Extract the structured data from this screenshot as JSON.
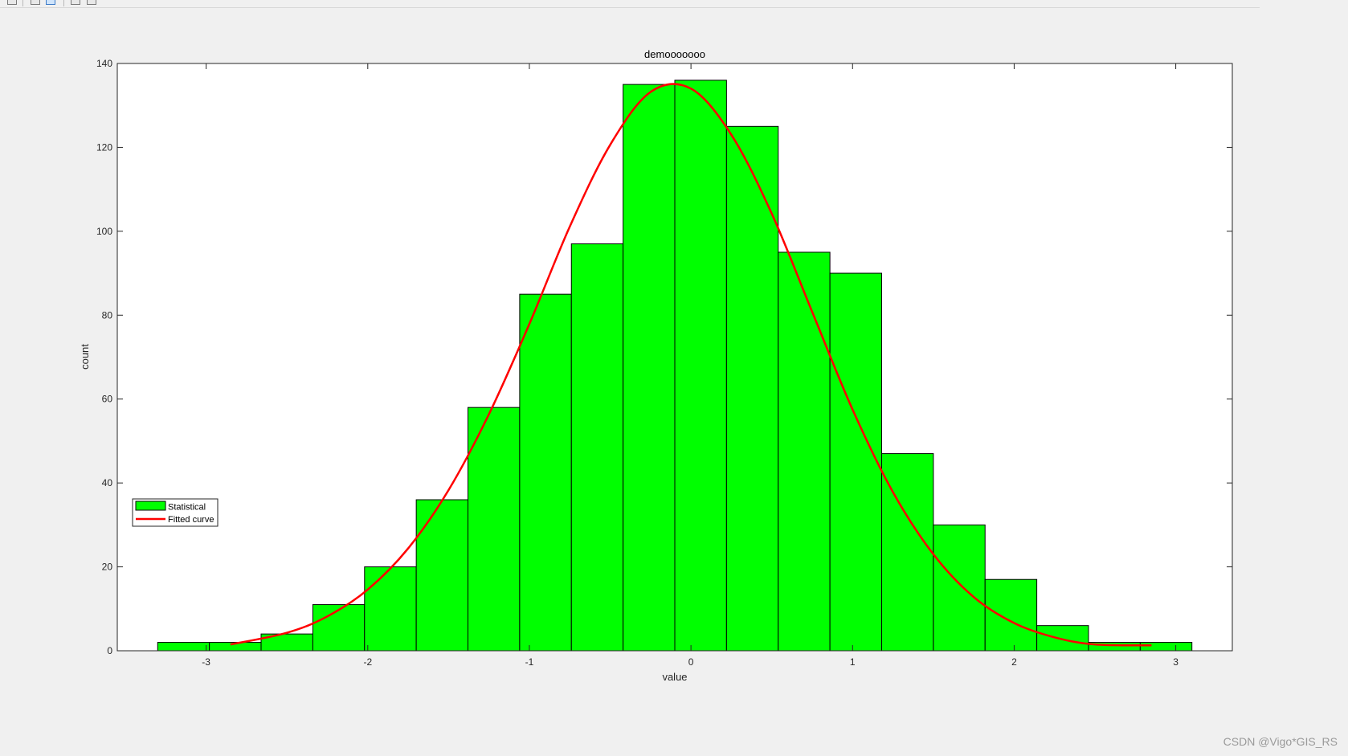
{
  "toolbar": {
    "buttons": [
      "save-icon",
      "print-icon",
      "zoom-icon",
      "pointer-icon",
      "data-cursor-icon"
    ]
  },
  "watermark": "CSDN @Vigo*GIS_RS",
  "chart_data": {
    "type": "bar",
    "title": "demooooooo",
    "xlabel": "value",
    "ylabel": "count",
    "xlim": [
      -3.55,
      3.35
    ],
    "ylim": [
      0,
      140
    ],
    "xticks": [
      -3,
      -2,
      -1,
      0,
      1,
      2,
      3
    ],
    "yticks": [
      0,
      20,
      40,
      60,
      80,
      100,
      120,
      140
    ],
    "bar_color": "#00ff00",
    "curve_color": "#ff0000",
    "legend_position": "left",
    "series": [
      {
        "name": "Statistical",
        "kind": "histogram",
        "bin_edges": [
          -3.3,
          -2.98,
          -2.66,
          -2.34,
          -2.02,
          -1.7,
          -1.38,
          -1.06,
          -0.74,
          -0.42,
          -0.1,
          0.22,
          0.54,
          0.86,
          1.18,
          1.5,
          1.82,
          2.14,
          2.46,
          2.78,
          3.1
        ],
        "values": [
          2,
          2,
          4,
          11,
          20,
          36,
          58,
          85,
          97,
          135,
          136,
          125,
          95,
          90,
          47,
          30,
          17,
          6,
          2,
          2
        ]
      },
      {
        "name": "Fitted curve",
        "kind": "line",
        "x": [
          -2.85,
          -2.5,
          -2.25,
          -2.0,
          -1.75,
          -1.5,
          -1.25,
          -1.0,
          -0.75,
          -0.5,
          -0.25,
          0.0,
          0.25,
          0.5,
          0.75,
          1.0,
          1.25,
          1.5,
          1.75,
          2.0,
          2.25,
          2.5,
          2.85
        ],
        "y": [
          1.5,
          4.3,
          8.2,
          14.6,
          24.4,
          38.3,
          56.4,
          77.9,
          101.1,
          120.6,
          133.2,
          134.0,
          123.0,
          104.2,
          80.8,
          57.5,
          37.8,
          23.0,
          12.8,
          6.6,
          3.2,
          1.5,
          1.3
        ]
      }
    ]
  }
}
